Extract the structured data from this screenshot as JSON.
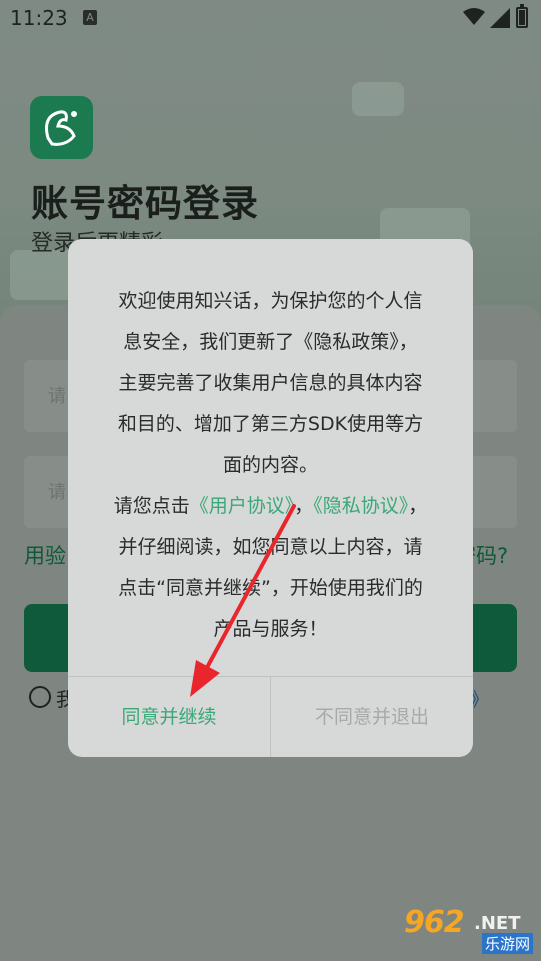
{
  "status_bar": {
    "time": "11:23",
    "notification_icon": "A"
  },
  "app": {
    "title": "账号密码登录",
    "subtitle": "登录后更精彩",
    "logo_icon": "swan-logo-icon",
    "brand_color": "#1c7a50"
  },
  "login_form": {
    "username_placeholder": "请",
    "password_placeholder": "请",
    "code_login_link": "用验",
    "forgot_password_link": "密码?",
    "agreement_radio_label": "我",
    "agreement_tail": "》"
  },
  "dialog": {
    "line1": "欢迎使用知兴话，为保护您的个人信",
    "line2": "息安全，我们更新了《隐私政策》，",
    "line3": "主要完善了收集用户信息的具体内容",
    "line4": "和目的、增加了第三方SDK使用等方",
    "line5": "面的内容。",
    "line6_prefix": "请您点击",
    "user_agreement": "《用户协议》",
    "line6_sep": "，",
    "privacy_agreement": "《隐私协议》",
    "line6_suffix": "，",
    "line7": "并仔细阅读，如您同意以上内容，请",
    "line8": "点击“同意并继续”，开始使用我们的",
    "line9": "产品与服务！",
    "agree_button": "同意并继续",
    "disagree_button": "不同意并退出",
    "accent_color": "#3aa878"
  },
  "watermark": {
    "brand": "962",
    "domain": ".NET",
    "site": "乐游网"
  }
}
